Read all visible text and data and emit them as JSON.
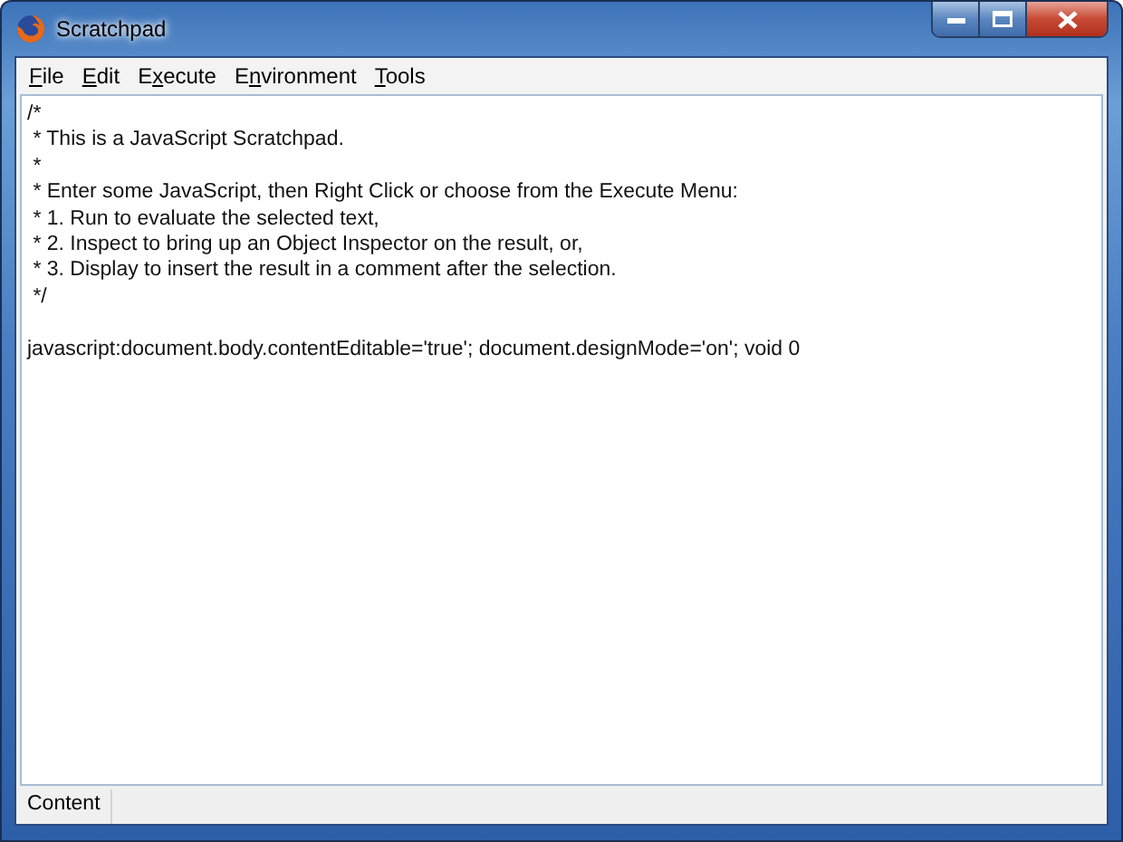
{
  "window": {
    "title": "Scratchpad"
  },
  "menu": [
    {
      "key": "F",
      "post": "ile"
    },
    {
      "key": "E",
      "post": "dit"
    },
    {
      "pre": "E",
      "key": "x",
      "post": "ecute"
    },
    {
      "pre": "E",
      "key": "n",
      "post": "vironment"
    },
    {
      "key": "T",
      "post": "ools"
    }
  ],
  "editor": {
    "lines": [
      {
        "text": "/*"
      },
      {
        "text": " * This is a JavaScript Scratchpad."
      },
      {
        "text": " *"
      },
      {
        "text": " * Enter some JavaScript, then Right Click or choose from the Execute Menu:"
      },
      {
        "text": " * 1. Run to evaluate the selected text,"
      },
      {
        "text": " * 2. Inspect to bring up an Object Inspector on the result, or,"
      },
      {
        "text": " * 3. Display to insert the result in a comment after the selection."
      },
      {
        "text": " */"
      },
      {
        "text": "javascript:document.body.contentEditable='true'; document.designMode='on'; void 0",
        "blank_line_before": true
      }
    ]
  },
  "status_bar": {
    "text": "Content"
  }
}
